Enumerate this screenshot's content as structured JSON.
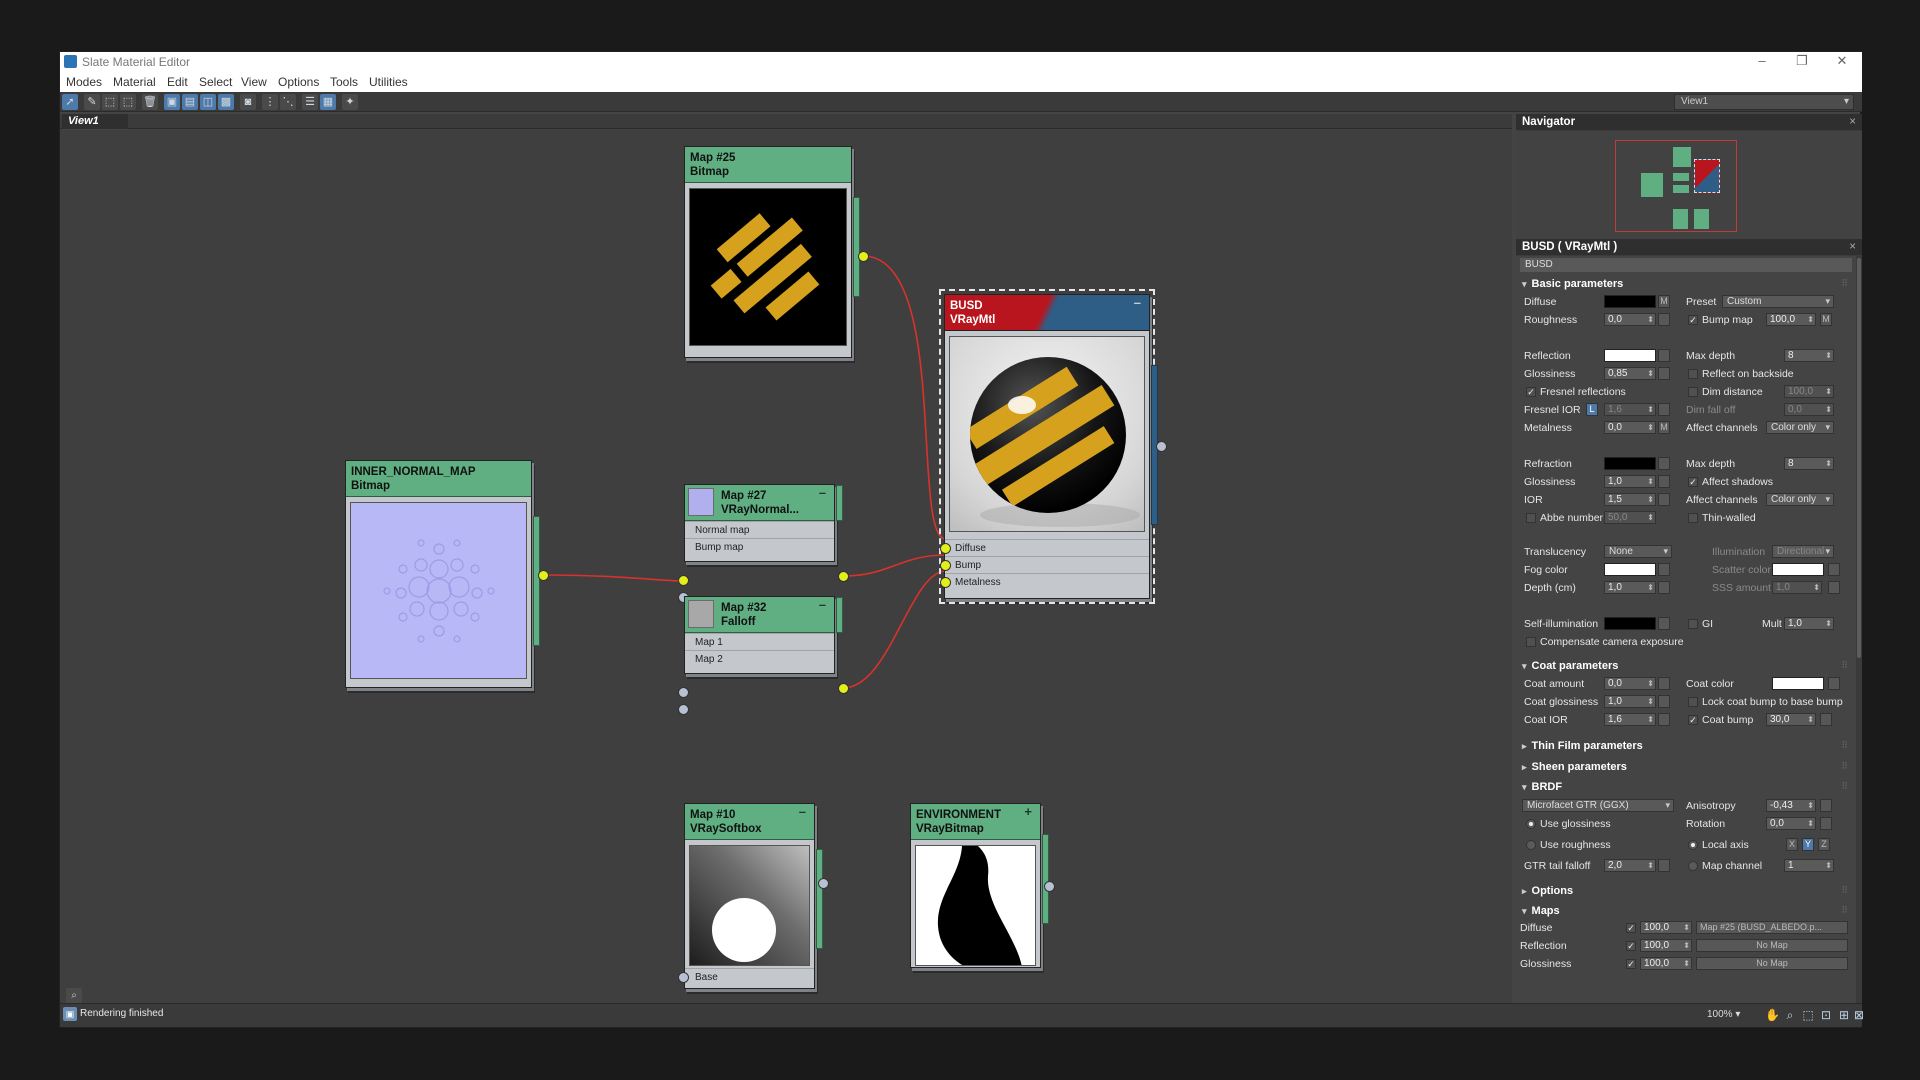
{
  "window": {
    "title": "Slate Material Editor"
  },
  "menu": [
    "Modes",
    "Material",
    "Edit",
    "Select",
    "View",
    "Options",
    "Tools",
    "Utilities"
  ],
  "view_dropdown": "View1",
  "view_tab": "View1",
  "nodes": {
    "map25": {
      "title": "Map #25",
      "type": "Bitmap"
    },
    "inner": {
      "title": "INNER_NORMAL_MAP",
      "type": "Bitmap"
    },
    "map27": {
      "title": "Map #27",
      "type": "VRayNormal...",
      "slots": [
        "Normal map",
        "Bump map"
      ]
    },
    "map32": {
      "title": "Map #32",
      "type": "Falloff",
      "slots": [
        "Map 1",
        "Map 2"
      ]
    },
    "busd": {
      "title": "BUSD",
      "type": "VRayMtl",
      "slots": [
        "Diffuse",
        "Bump",
        "Metalness"
      ]
    },
    "map10": {
      "title": "Map #10",
      "type": "VRaySoftbox",
      "slots": [
        "Base"
      ]
    },
    "env": {
      "title": "ENVIRONMENT",
      "type": "VRayBitmap"
    }
  },
  "status": "Rendering finished",
  "zoom": "100%",
  "navigator": {
    "title": "Navigator"
  },
  "props": {
    "header": "BUSD  ( VRayMtl )",
    "name": "BUSD",
    "basic": "Basic parameters",
    "diffuse": "Diffuse",
    "preset": "Preset",
    "preset_value": "Custom",
    "roughness": "Roughness",
    "roughness_value": "0,0",
    "bump_map": "Bump map",
    "bump_map_value": "100,0",
    "reflection": "Reflection",
    "max_depth": "Max depth",
    "max_depth_value": "8",
    "glossiness": "Glossiness",
    "glossiness_value": "0,85",
    "reflect_backside": "Reflect on backside",
    "fresnel": "Fresnel reflections",
    "dim_distance": "Dim distance",
    "dim_distance_value": "100,0",
    "fresnel_ior": "Fresnel IOR",
    "fresnel_ior_value": "1,6",
    "dim_falloff": "Dim fall off",
    "dim_falloff_value": "0,0",
    "metalness": "Metalness",
    "metalness_value": "0,0",
    "affect_channels": "Affect channels",
    "color_only": "Color only",
    "refraction": "Refraction",
    "refr_max_depth_value": "8",
    "refr_glossiness_value": "1,0",
    "affect_shadows": "Affect shadows",
    "ior": "IOR",
    "ior_value": "1,5",
    "abbe": "Abbe number",
    "abbe_value": "50,0",
    "thin_walled": "Thin-walled",
    "translucency": "Translucency",
    "translucency_value": "None",
    "illumination": "Illumination",
    "illumination_value": "Directional",
    "fog_color": "Fog color",
    "scatter_color": "Scatter color",
    "depth_cm": "Depth (cm)",
    "depth_value": "1,0",
    "sss_amount": "SSS amount",
    "sss_value": "1,0",
    "self_illum": "Self-illumination",
    "gi": "GI",
    "mult": "Mult",
    "mult_value": "1,0",
    "compensate": "Compensate camera exposure",
    "coat": "Coat parameters",
    "coat_amount": "Coat amount",
    "coat_amount_value": "0,0",
    "coat_color": "Coat color",
    "coat_gloss": "Coat glossiness",
    "coat_gloss_value": "1,0",
    "lock_coat": "Lock coat bump to base bump",
    "coat_ior": "Coat IOR",
    "coat_ior_value": "1,6",
    "coat_bump": "Coat bump",
    "coat_bump_value": "30,0",
    "thin_film": "Thin Film parameters",
    "sheen": "Sheen parameters",
    "brdf": "BRDF",
    "brdf_type": "Microfacet GTR (GGX)",
    "anisotropy": "Anisotropy",
    "anisotropy_value": "-0,43",
    "use_gloss": "Use glossiness",
    "rotation": "Rotation",
    "rotation_value": "0,0",
    "use_rough": "Use roughness",
    "local_axis": "Local axis",
    "axis_x": "X",
    "axis_y": "Y",
    "axis_z": "Z",
    "gtr": "GTR tail falloff",
    "gtr_value": "2,0",
    "map_channel": "Map channel",
    "map_channel_value": "1",
    "options": "Options",
    "maps": "Maps",
    "maps_rows": [
      {
        "label": "Diffuse",
        "amount": "100,0",
        "map": "Map #25 (BUSD_ALBEDO.p..."
      },
      {
        "label": "Reflection",
        "amount": "100,0",
        "map": "No Map"
      },
      {
        "label": "Glossiness",
        "amount": "100,0",
        "map": "No Map"
      }
    ]
  },
  "colors": {
    "node_header": "#5faf82",
    "material_header_red": "#b8151f",
    "material_header_blue": "#2e5e85",
    "wire": "#d8322c",
    "socket": "#e2ef1a",
    "logo_gold": "#d6a21d"
  }
}
